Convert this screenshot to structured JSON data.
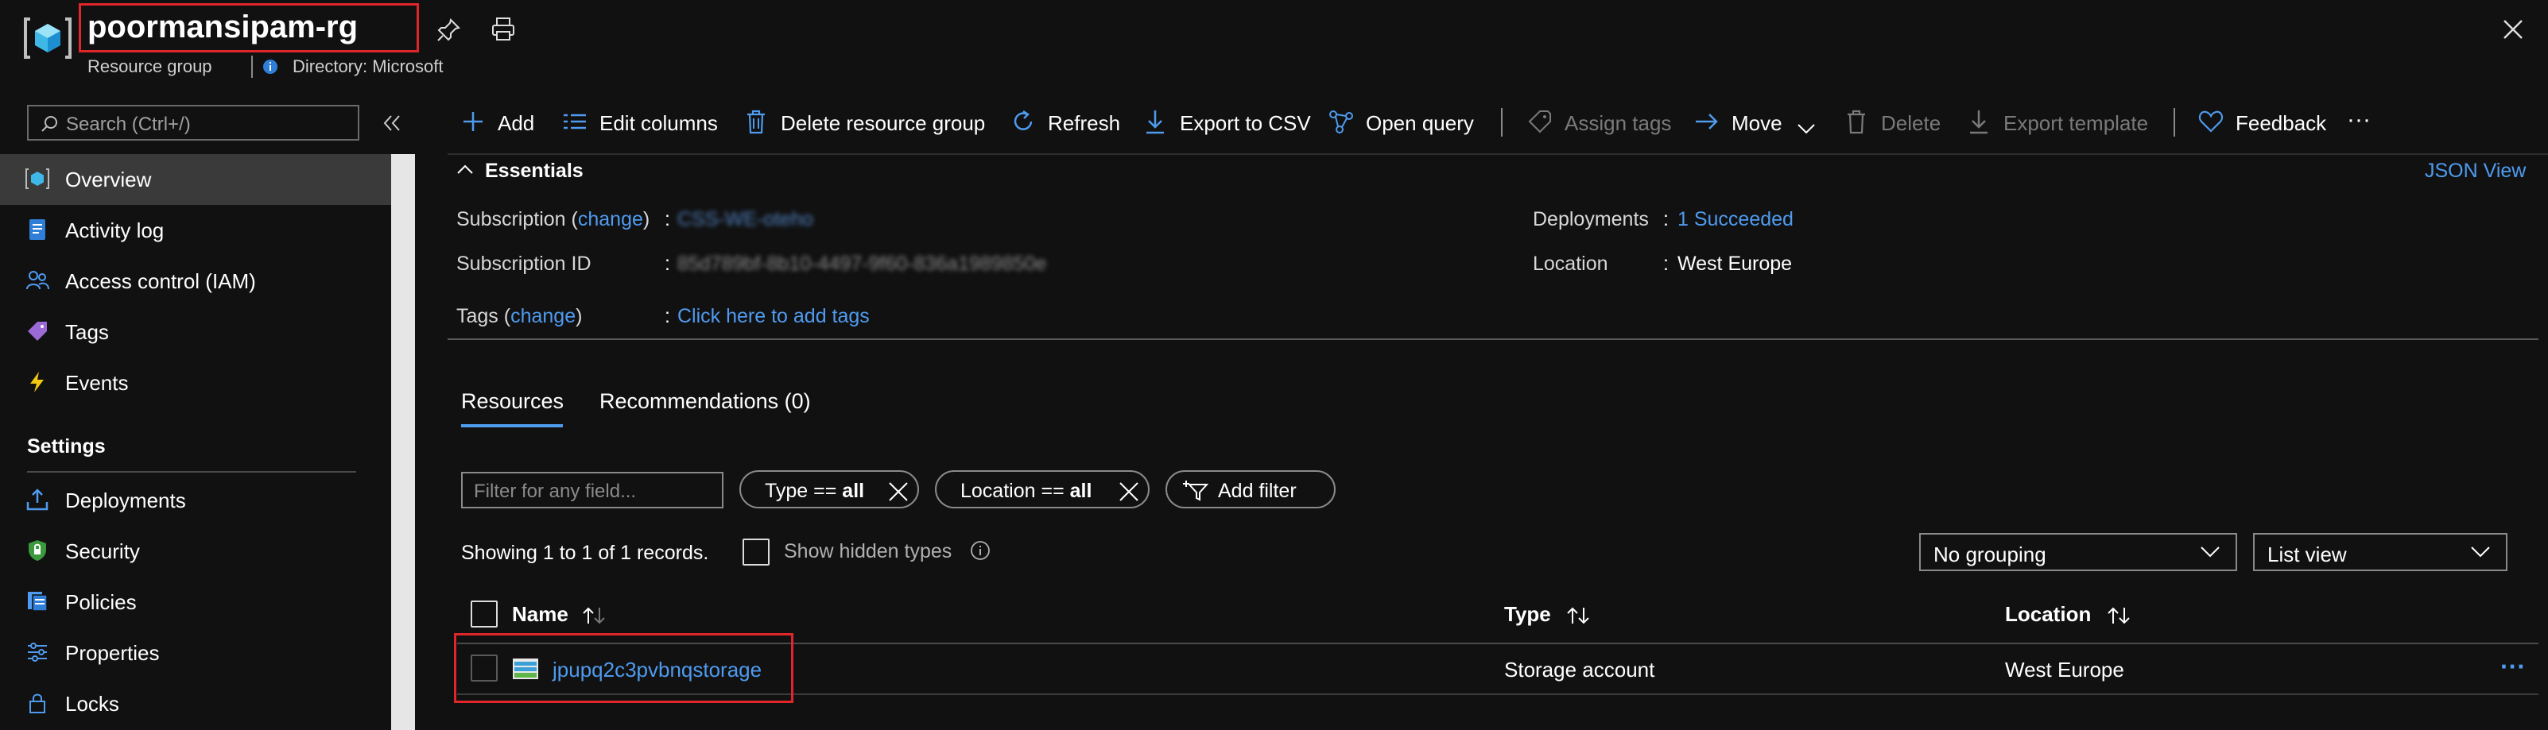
{
  "header": {
    "title": "poormansipam-rg",
    "resource_type": "Resource group",
    "directory": "Directory: Microsoft"
  },
  "sidebar": {
    "search_placeholder": "Search (Ctrl+/)",
    "items": [
      {
        "label": "Overview",
        "icon": "resource-group-icon",
        "selected": true
      },
      {
        "label": "Activity log",
        "icon": "activity-log-icon"
      },
      {
        "label": "Access control (IAM)",
        "icon": "people-icon"
      },
      {
        "label": "Tags",
        "icon": "tag-icon"
      },
      {
        "label": "Events",
        "icon": "lightning-icon"
      }
    ],
    "settings_heading": "Settings",
    "settings_items": [
      {
        "label": "Deployments",
        "icon": "deployments-icon"
      },
      {
        "label": "Security",
        "icon": "shield-icon"
      },
      {
        "label": "Policies",
        "icon": "policies-icon"
      },
      {
        "label": "Properties",
        "icon": "properties-icon"
      },
      {
        "label": "Locks",
        "icon": "lock-icon"
      }
    ]
  },
  "toolbar": {
    "add": "Add",
    "edit_columns": "Edit columns",
    "delete_group": "Delete resource group",
    "refresh": "Refresh",
    "export_csv": "Export to CSV",
    "open_query": "Open query",
    "assign_tags": "Assign tags",
    "move": "Move",
    "delete": "Delete",
    "export_template": "Export template",
    "feedback": "Feedback",
    "more": "···"
  },
  "essentials": {
    "heading": "Essentials",
    "json_view": "JSON View",
    "subscription_label": "Subscription",
    "change": "change",
    "subscription_value": "CSS-WE-oteho",
    "subscription_id_label": "Subscription ID",
    "subscription_id_value": "85d789bf-8b10-4497-9f60-836a1989850e",
    "tags_label": "Tags",
    "tags_value": "Click here to add tags",
    "deployments_label": "Deployments",
    "deployments_value": "1 Succeeded",
    "location_label": "Location",
    "location_value": "West Europe",
    "colon": ":"
  },
  "tabs": {
    "resources": "Resources",
    "recommendations": "Recommendations (0)"
  },
  "filters": {
    "filter_placeholder": "Filter for any field...",
    "type_prefix": "Type == ",
    "type_value": "all",
    "location_prefix": "Location == ",
    "location_value": "all",
    "add_filter": "Add filter"
  },
  "records": {
    "showing": "Showing 1 to 1 of 1 records.",
    "show_hidden": "Show hidden types",
    "grouping": "No grouping",
    "view": "List view"
  },
  "table": {
    "columns": [
      "Name",
      "Type",
      "Location"
    ],
    "rows": [
      {
        "name": "jpupq2c3pvbnqstorage",
        "type": "Storage account",
        "location": "West Europe",
        "icon": "storage-account-icon"
      }
    ],
    "row_more": "···"
  },
  "colors": {
    "accent": "#4f9bef",
    "highlight_border": "#e0262b",
    "background": "#111111",
    "selected_bg": "#3a3a3a"
  }
}
